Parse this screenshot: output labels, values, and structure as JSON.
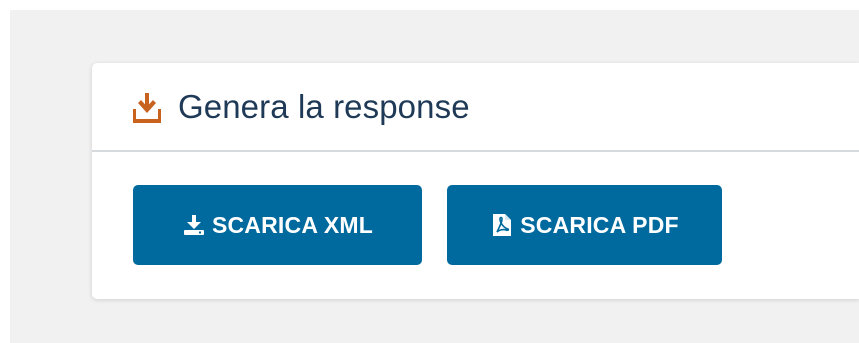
{
  "card": {
    "title": "Genera la response",
    "title_icon": "download-icon"
  },
  "buttons": {
    "xml": {
      "label": "SCARICA XML",
      "icon": "download-icon"
    },
    "pdf": {
      "label": "SCARICA PDF",
      "icon": "file-pdf-icon"
    }
  },
  "colors": {
    "accent_icon": "#c8621f",
    "button_bg": "#006a9e",
    "title_text": "#1f3a56",
    "page_bg": "#f2f1f1"
  }
}
